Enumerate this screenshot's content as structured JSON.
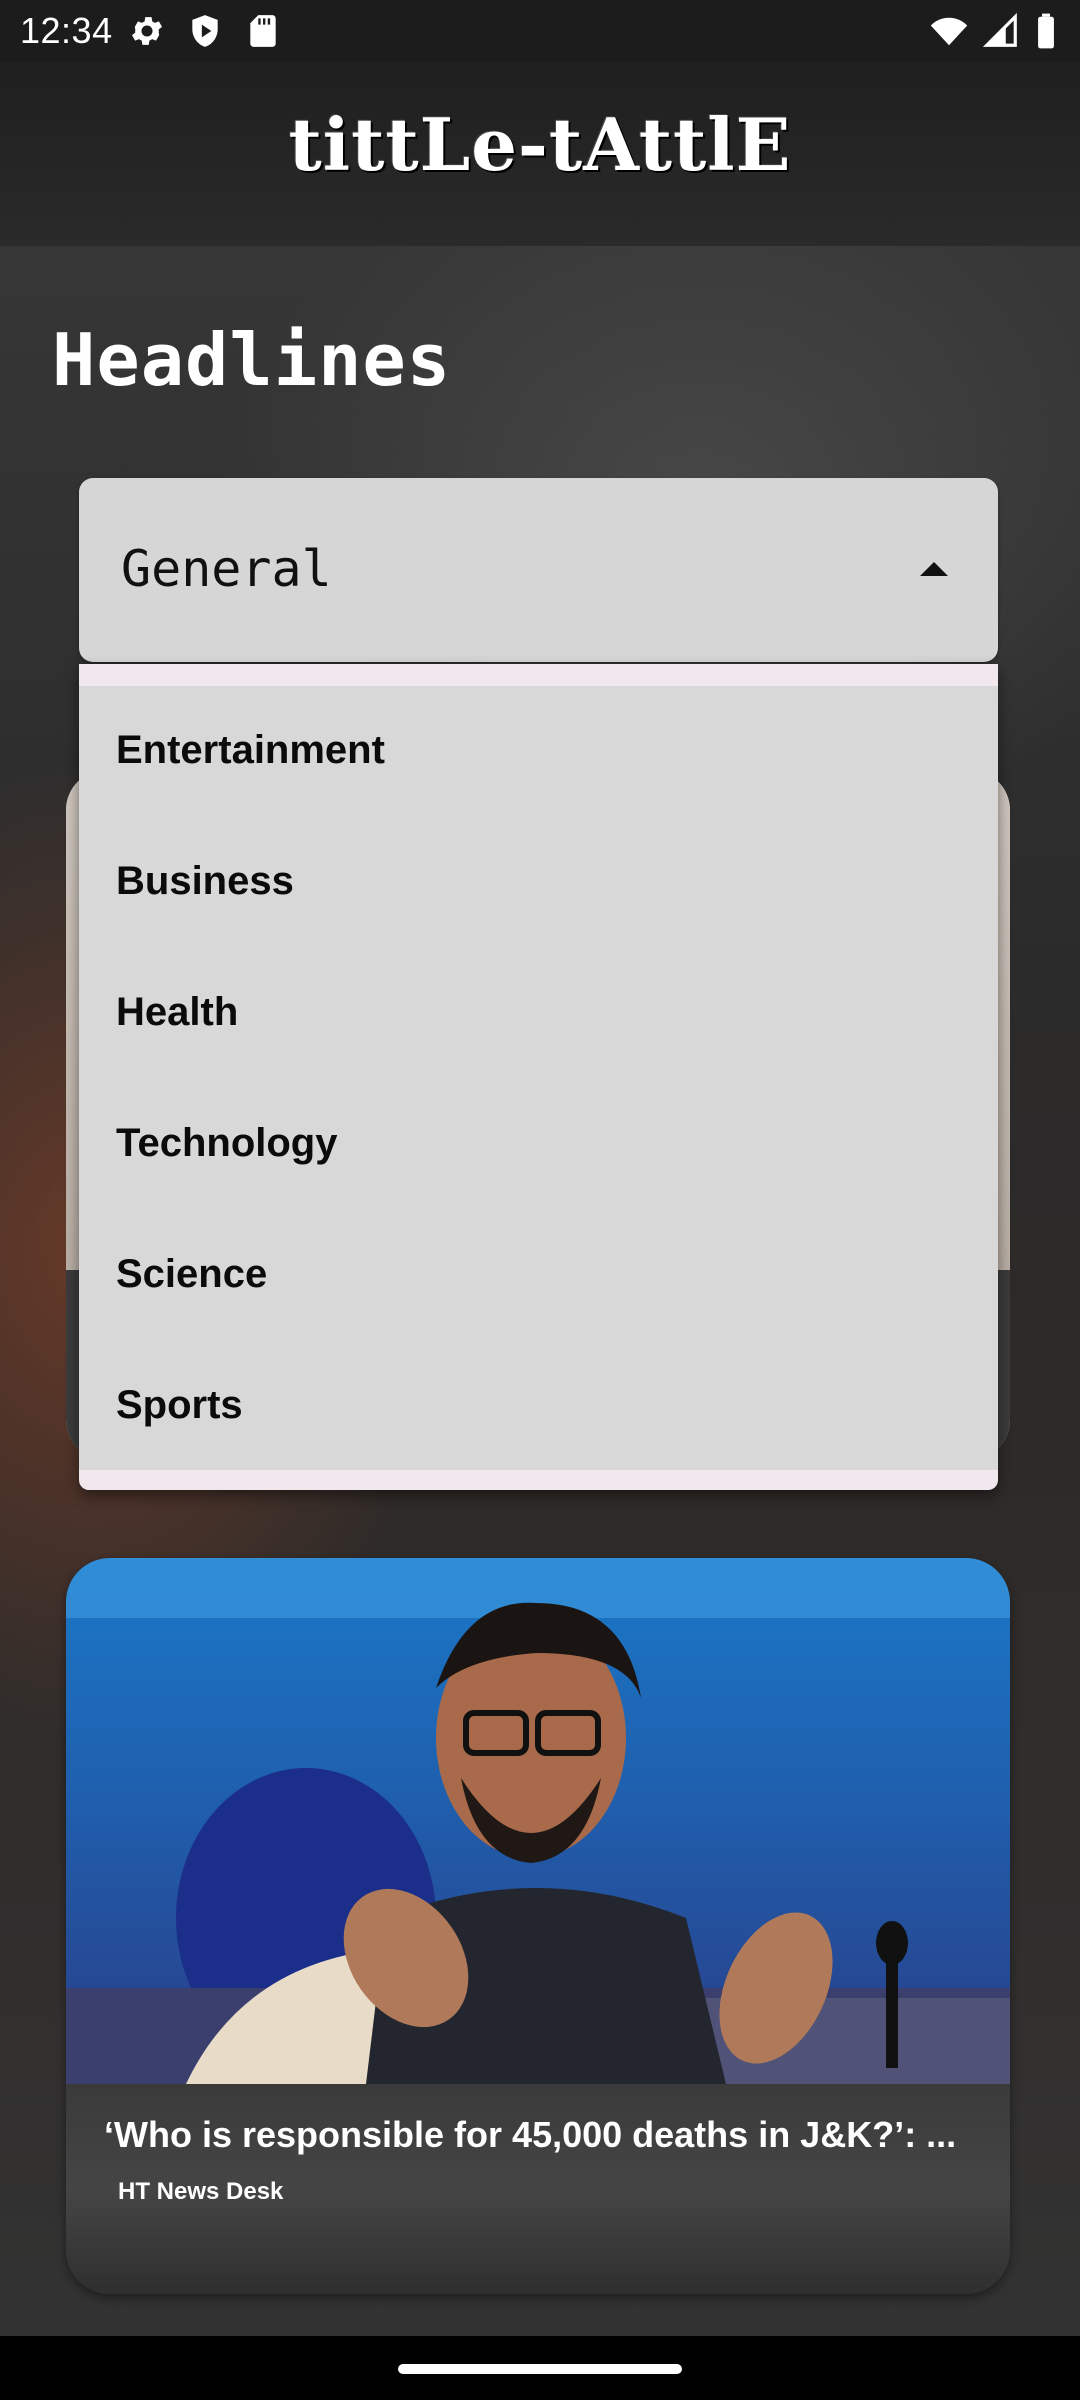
{
  "status_bar": {
    "time": "12:34",
    "left_icons": [
      "settings-icon",
      "play-protect-icon",
      "sd-card-icon"
    ],
    "right_icons": [
      "wifi-icon",
      "signal-icon",
      "battery-icon"
    ]
  },
  "app_bar": {
    "logo_text": "tittLe-tAttlE"
  },
  "page": {
    "title": "Headlines"
  },
  "category_dropdown": {
    "selected": "General",
    "expanded": true,
    "options": [
      "Entertainment",
      "Business",
      "Health",
      "Technology",
      "Science",
      "Sports"
    ]
  },
  "articles": [
    {
      "title": "‘Who is responsible for 45,000 deaths in J&K?’: ...",
      "source": "HT News Desk"
    }
  ],
  "colors": {
    "dropdown_bg": "#d6d6d6",
    "menu_bg": "#d8d8d8",
    "menu_border": "#f1e8ee",
    "text_dark": "#0b0b0b"
  }
}
